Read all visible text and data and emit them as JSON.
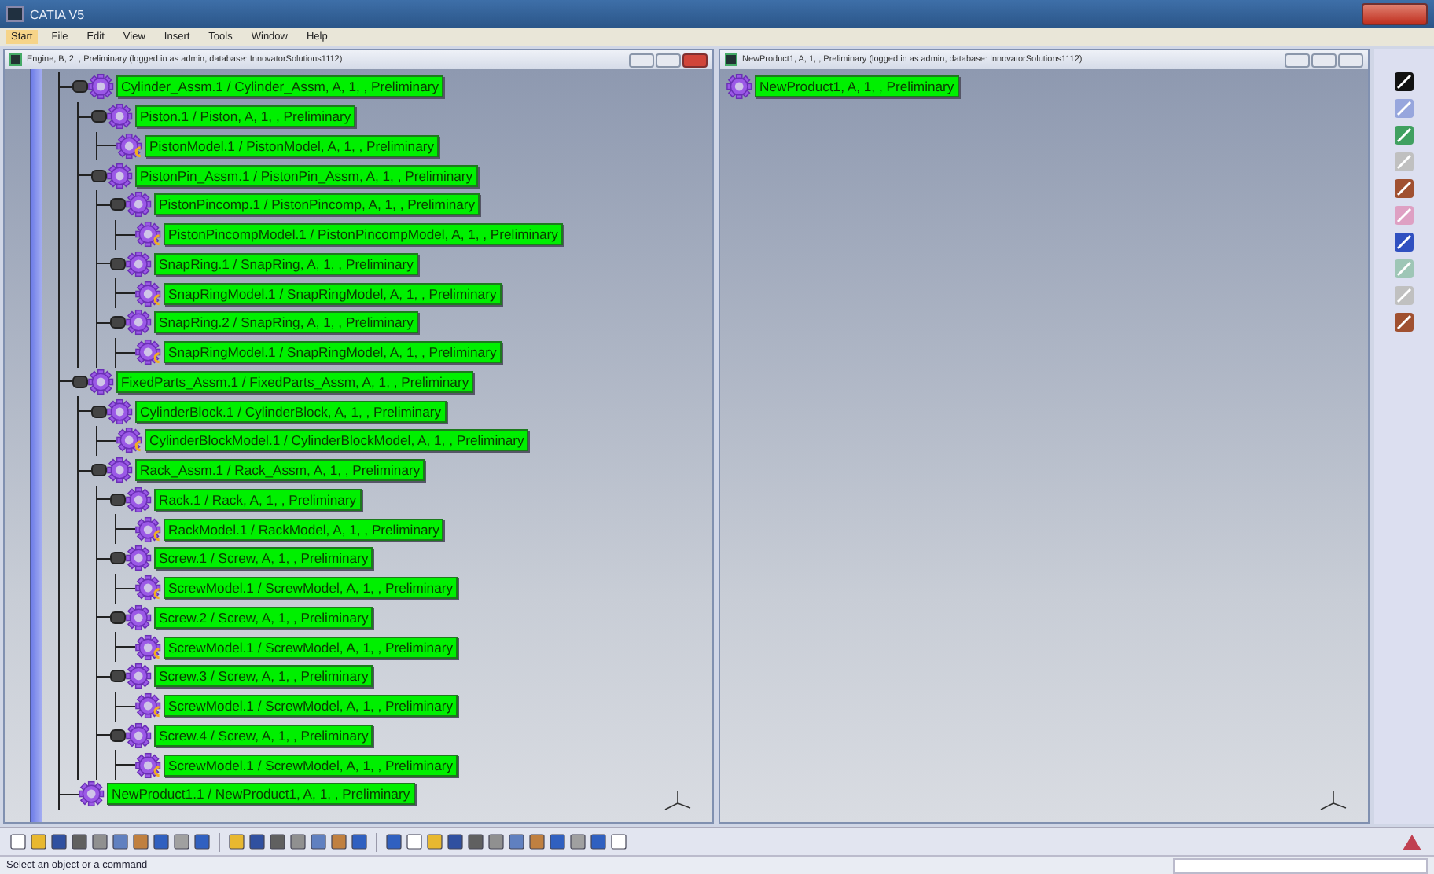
{
  "app": {
    "title": "CATIA V5"
  },
  "menu": [
    {
      "label": "Start",
      "selected": true
    },
    {
      "label": "File",
      "selected": false
    },
    {
      "label": "Edit",
      "selected": false
    },
    {
      "label": "View",
      "selected": false
    },
    {
      "label": "Insert",
      "selected": false
    },
    {
      "label": "Tools",
      "selected": false
    },
    {
      "label": "Window",
      "selected": false
    },
    {
      "label": "Help",
      "selected": false
    }
  ],
  "windows": [
    {
      "title": "Engine, B, 2, , Preliminary (logged in as admin, database: InnovatorSolutions1112)",
      "active": true,
      "tree": [
        {
          "label": "Cylinder_Assm.1 / Cylinder_Assm, A, 1, , Preliminary",
          "kind": "product",
          "expanded": true,
          "children": [
            {
              "label": "Piston.1 / Piston, A, 1, , Preliminary",
              "kind": "product",
              "expanded": true,
              "children": [
                {
                  "label": "PistonModel.1 / PistonModel, A, 1, , Preliminary",
                  "kind": "part"
                }
              ]
            },
            {
              "label": "PistonPin_Assm.1 / PistonPin_Assm, A, 1, , Preliminary",
              "kind": "product",
              "expanded": true,
              "children": [
                {
                  "label": "PistonPincomp.1 / PistonPincomp, A, 1, , Preliminary",
                  "kind": "product",
                  "expanded": true,
                  "children": [
                    {
                      "label": "PistonPincompModel.1 / PistonPincompModel, A, 1, , Preliminary",
                      "kind": "part"
                    }
                  ]
                },
                {
                  "label": "SnapRing.1 / SnapRing, A, 1, , Preliminary",
                  "kind": "product",
                  "expanded": true,
                  "children": [
                    {
                      "label": "SnapRingModel.1 / SnapRingModel, A, 1, , Preliminary",
                      "kind": "part"
                    }
                  ]
                },
                {
                  "label": "SnapRing.2 / SnapRing, A, 1, , Preliminary",
                  "kind": "product",
                  "expanded": true,
                  "children": [
                    {
                      "label": "SnapRingModel.1 / SnapRingModel, A, 1, , Preliminary",
                      "kind": "part"
                    }
                  ]
                }
              ]
            }
          ]
        },
        {
          "label": "FixedParts_Assm.1 / FixedParts_Assm, A, 1, , Preliminary",
          "kind": "product",
          "expanded": true,
          "children": [
            {
              "label": "CylinderBlock.1 / CylinderBlock, A, 1, , Preliminary",
              "kind": "product",
              "expanded": true,
              "children": [
                {
                  "label": "CylinderBlockModel.1 / CylinderBlockModel, A, 1, , Preliminary",
                  "kind": "part"
                }
              ]
            },
            {
              "label": "Rack_Assm.1 / Rack_Assm, A, 1, , Preliminary",
              "kind": "product",
              "expanded": true,
              "children": [
                {
                  "label": "Rack.1 / Rack, A, 1, , Preliminary",
                  "kind": "product",
                  "expanded": true,
                  "children": [
                    {
                      "label": "RackModel.1 / RackModel, A, 1, , Preliminary",
                      "kind": "part"
                    }
                  ]
                },
                {
                  "label": "Screw.1 / Screw, A, 1, , Preliminary",
                  "kind": "product",
                  "expanded": true,
                  "children": [
                    {
                      "label": "ScrewModel.1 / ScrewModel, A, 1, , Preliminary",
                      "kind": "part"
                    }
                  ]
                },
                {
                  "label": "Screw.2 / Screw, A, 1, , Preliminary",
                  "kind": "product",
                  "expanded": true,
                  "children": [
                    {
                      "label": "ScrewModel.1 / ScrewModel, A, 1, , Preliminary",
                      "kind": "part"
                    }
                  ]
                },
                {
                  "label": "Screw.3 / Screw, A, 1, , Preliminary",
                  "kind": "product",
                  "expanded": true,
                  "children": [
                    {
                      "label": "ScrewModel.1 / ScrewModel, A, 1, , Preliminary",
                      "kind": "part"
                    }
                  ]
                },
                {
                  "label": "Screw.4 / Screw, A, 1, , Preliminary",
                  "kind": "product",
                  "expanded": true,
                  "children": [
                    {
                      "label": "ScrewModel.1 / ScrewModel, A, 1, , Preliminary",
                      "kind": "part"
                    }
                  ]
                }
              ]
            }
          ]
        },
        {
          "label": "NewProduct1.1 / NewProduct1, A, 1, , Preliminary",
          "kind": "product"
        }
      ]
    },
    {
      "title": "NewProduct1, A, 1, , Preliminary (logged in as admin, database: InnovatorSolutions1112)",
      "active": false,
      "tree": [
        {
          "label": "NewProduct1, A, 1, , Preliminary",
          "kind": "product"
        }
      ]
    }
  ],
  "status_bar": "Select an object or a command"
}
